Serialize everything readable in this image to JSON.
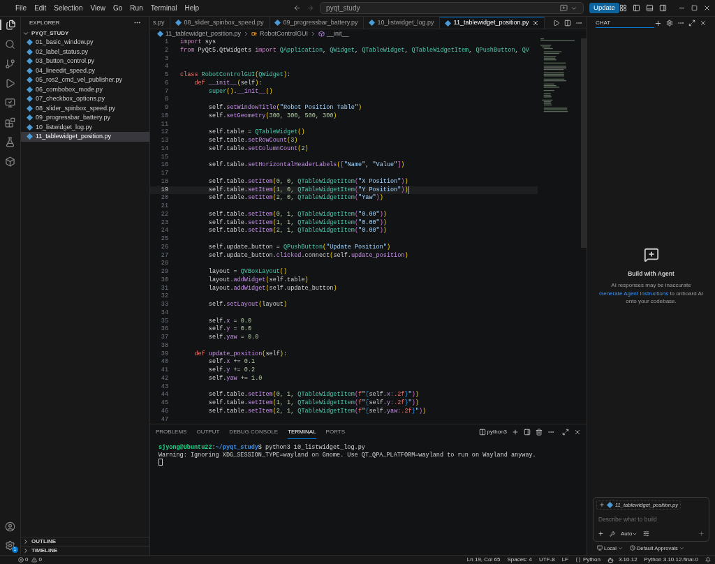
{
  "menu": [
    "File",
    "Edit",
    "Selection",
    "View",
    "Go",
    "Run",
    "Terminal",
    "Help"
  ],
  "command_center": {
    "text": "pyqt_study"
  },
  "update_button": "Update",
  "activity_bar": {
    "settings_badge": "1"
  },
  "explorer": {
    "title": "EXPLORER",
    "folder": "PYQT_STUDY",
    "expanded": true,
    "files": [
      {
        "name": "01_basic_window.py",
        "selected": false
      },
      {
        "name": "02_label_status.py",
        "selected": false
      },
      {
        "name": "03_button_control.py",
        "selected": false
      },
      {
        "name": "04_lineedit_speed.py",
        "selected": false
      },
      {
        "name": "05_ros2_cmd_vel_publisher.py",
        "selected": false
      },
      {
        "name": "06_combobox_mode.py",
        "selected": false
      },
      {
        "name": "07_checkbox_options.py",
        "selected": false
      },
      {
        "name": "08_slider_spinbox_speed.py",
        "selected": false
      },
      {
        "name": "09_progressbar_battery.py",
        "selected": false
      },
      {
        "name": "10_listwidget_log.py",
        "selected": false
      },
      {
        "name": "11_tablewidget_position.py",
        "selected": true
      }
    ],
    "sections": [
      "OUTLINE",
      "TIMELINE"
    ]
  },
  "tabs": [
    {
      "label": "s.py",
      "selected": false
    },
    {
      "label": "08_slider_spinbox_speed.py",
      "selected": false
    },
    {
      "label": "09_progressbar_battery.py",
      "selected": false
    },
    {
      "label": "10_listwidget_log.py",
      "selected": false
    },
    {
      "label": "11_tablewidget_position.py",
      "selected": true
    }
  ],
  "breadcrumb": [
    {
      "kind": "file",
      "text": "11_tablewidget_position.py"
    },
    {
      "kind": "class",
      "text": "RobotControlGUI"
    },
    {
      "kind": "method",
      "text": "__init__"
    }
  ],
  "code": [
    {
      "number": "1",
      "tokens": [
        {
          "kind": "import",
          "text": "import"
        },
        {
          "kind": "plain",
          "text": " sys"
        }
      ]
    },
    {
      "number": "2",
      "tokens": [
        {
          "kind": "import",
          "text": "from"
        },
        {
          "kind": "plain",
          "text": " PyQt5.QtWidgets "
        },
        {
          "kind": "import",
          "text": "import "
        },
        {
          "kind": "class",
          "text": "QApplication"
        },
        {
          "kind": "plain",
          "text": ", "
        },
        {
          "kind": "class",
          "text": "QWidget"
        },
        {
          "kind": "plain",
          "text": ", "
        },
        {
          "kind": "class",
          "text": "QTableWidget"
        },
        {
          "kind": "plain",
          "text": ", "
        },
        {
          "kind": "class",
          "text": "QTableWidgetItem"
        },
        {
          "kind": "plain",
          "text": ", "
        },
        {
          "kind": "class",
          "text": "QPushButton"
        },
        {
          "kind": "plain",
          "text": ", "
        },
        {
          "kind": "class",
          "text": "QV"
        }
      ]
    },
    {
      "number": "3"
    },
    {
      "number": "4"
    },
    {
      "number": "5",
      "tokens": [
        {
          "kind": "keyword",
          "text": "class "
        },
        {
          "kind": "class",
          "text": "RobotControlGUI"
        },
        {
          "kind": "bracket",
          "text": "("
        },
        {
          "kind": "class",
          "text": "QWidget"
        },
        {
          "kind": "bracket",
          "text": ")"
        },
        {
          "kind": "plain",
          "text": ":"
        }
      ]
    },
    {
      "number": "6",
      "tokens": [
        {
          "kind": "keyword",
          "text": "    def "
        },
        {
          "kind": "method",
          "text": "__init__"
        },
        {
          "kind": "bracket",
          "text": "("
        },
        {
          "kind": "plain",
          "text": "self"
        },
        {
          "kind": "bracket",
          "text": ")"
        },
        {
          "kind": "plain",
          "text": ":"
        }
      ]
    },
    {
      "number": "7",
      "tokens": [
        {
          "kind": "class",
          "text": "        super"
        },
        {
          "kind": "bracket",
          "text": "()"
        },
        {
          "kind": "plain",
          "text": "."
        },
        {
          "kind": "method",
          "text": "__init__"
        },
        {
          "kind": "bracket",
          "text": "()"
        }
      ]
    },
    {
      "number": "8"
    },
    {
      "number": "9",
      "tokens": [
        {
          "kind": "plain",
          "text": "        self."
        },
        {
          "kind": "method",
          "text": "setWindowTitle"
        },
        {
          "kind": "bracket",
          "text": "("
        },
        {
          "kind": "string",
          "text": "\"Robot Position Table\""
        },
        {
          "kind": "bracket",
          "text": ")"
        }
      ]
    },
    {
      "number": "10",
      "tokens": [
        {
          "kind": "plain",
          "text": "        self."
        },
        {
          "kind": "method",
          "text": "setGeometry"
        },
        {
          "kind": "bracket",
          "text": "("
        },
        {
          "kind": "number",
          "text": "300, 300, 500, 300"
        },
        {
          "kind": "bracket",
          "text": ")"
        }
      ]
    },
    {
      "number": "11"
    },
    {
      "number": "12",
      "tokens": [
        {
          "kind": "plain",
          "text": "        self.table = "
        },
        {
          "kind": "class",
          "text": "QTableWidget"
        },
        {
          "kind": "bracket",
          "text": "()"
        }
      ]
    },
    {
      "number": "13",
      "tokens": [
        {
          "kind": "plain",
          "text": "        self.table."
        },
        {
          "kind": "method",
          "text": "setRowCount"
        },
        {
          "kind": "bracket",
          "text": "("
        },
        {
          "kind": "number",
          "text": "3"
        },
        {
          "kind": "bracket",
          "text": ")"
        }
      ]
    },
    {
      "number": "14",
      "tokens": [
        {
          "kind": "plain",
          "text": "        self.table."
        },
        {
          "kind": "method",
          "text": "setColumnCount"
        },
        {
          "kind": "bracket",
          "text": "("
        },
        {
          "kind": "number",
          "text": "2"
        },
        {
          "kind": "bracket",
          "text": ")"
        }
      ]
    },
    {
      "number": "15"
    },
    {
      "number": "16",
      "tokens": [
        {
          "kind": "plain",
          "text": "        self.table."
        },
        {
          "kind": "method",
          "text": "setHorizontalHeaderLabels"
        },
        {
          "kind": "bracket",
          "text": "("
        },
        {
          "kind": "bracket2",
          "text": "["
        },
        {
          "kind": "string",
          "text": "\"Name\""
        },
        {
          "kind": "plain",
          "text": ", "
        },
        {
          "kind": "string",
          "text": "\"Value\""
        },
        {
          "kind": "bracket2",
          "text": "]"
        },
        {
          "kind": "bracket",
          "text": ")"
        }
      ]
    },
    {
      "number": "17"
    },
    {
      "number": "18",
      "tokens": [
        {
          "kind": "plain",
          "text": "        self.table."
        },
        {
          "kind": "method",
          "text": "setItem"
        },
        {
          "kind": "bracket",
          "text": "("
        },
        {
          "kind": "number",
          "text": "0, 0, "
        },
        {
          "kind": "class",
          "text": "QTableWidgetItem"
        },
        {
          "kind": "bracket2",
          "text": "("
        },
        {
          "kind": "string",
          "text": "\"X Position\""
        },
        {
          "kind": "bracket2",
          "text": ")"
        },
        {
          "kind": "bracket",
          "text": ")"
        }
      ]
    },
    {
      "number": "19",
      "current": true,
      "tokens": [
        {
          "kind": "plain",
          "text": "        self.table."
        },
        {
          "kind": "method",
          "text": "setItem"
        },
        {
          "kind": "bracket",
          "text": "("
        },
        {
          "kind": "number",
          "text": "1, 0, "
        },
        {
          "kind": "class",
          "text": "QTableWidgetItem"
        },
        {
          "kind": "bracket2",
          "text": "("
        },
        {
          "kind": "string",
          "text": "\"Y Position\""
        },
        {
          "kind": "bracket2",
          "text": ")"
        },
        {
          "kind": "bracket",
          "text": ")"
        }
      ]
    },
    {
      "number": "20",
      "tokens": [
        {
          "kind": "plain",
          "text": "        self.table."
        },
        {
          "kind": "method",
          "text": "setItem"
        },
        {
          "kind": "bracket",
          "text": "("
        },
        {
          "kind": "number",
          "text": "2, 0, "
        },
        {
          "kind": "class",
          "text": "QTableWidgetItem"
        },
        {
          "kind": "bracket2",
          "text": "("
        },
        {
          "kind": "string",
          "text": "\"Yaw\""
        },
        {
          "kind": "bracket2",
          "text": ")"
        },
        {
          "kind": "bracket",
          "text": ")"
        }
      ]
    },
    {
      "number": "21"
    },
    {
      "number": "22",
      "tokens": [
        {
          "kind": "plain",
          "text": "        self.table."
        },
        {
          "kind": "method",
          "text": "setItem"
        },
        {
          "kind": "bracket",
          "text": "("
        },
        {
          "kind": "number",
          "text": "0, 1, "
        },
        {
          "kind": "class",
          "text": "QTableWidgetItem"
        },
        {
          "kind": "bracket2",
          "text": "("
        },
        {
          "kind": "string",
          "text": "\"0.00\""
        },
        {
          "kind": "bracket2",
          "text": ")"
        },
        {
          "kind": "bracket",
          "text": ")"
        }
      ]
    },
    {
      "number": "23",
      "tokens": [
        {
          "kind": "plain",
          "text": "        self.table."
        },
        {
          "kind": "method",
          "text": "setItem"
        },
        {
          "kind": "bracket",
          "text": "("
        },
        {
          "kind": "number",
          "text": "1, 1, "
        },
        {
          "kind": "class",
          "text": "QTableWidgetItem"
        },
        {
          "kind": "bracket2",
          "text": "("
        },
        {
          "kind": "string",
          "text": "\"0.00\""
        },
        {
          "kind": "bracket2",
          "text": ")"
        },
        {
          "kind": "bracket",
          "text": ")"
        }
      ]
    },
    {
      "number": "24",
      "tokens": [
        {
          "kind": "plain",
          "text": "        self.table."
        },
        {
          "kind": "method",
          "text": "setItem"
        },
        {
          "kind": "bracket",
          "text": "("
        },
        {
          "kind": "number",
          "text": "2, 1, "
        },
        {
          "kind": "class",
          "text": "QTableWidgetItem"
        },
        {
          "kind": "bracket2",
          "text": "("
        },
        {
          "kind": "string",
          "text": "\"0.00\""
        },
        {
          "kind": "bracket2",
          "text": ")"
        },
        {
          "kind": "bracket",
          "text": ")"
        }
      ]
    },
    {
      "number": "25"
    },
    {
      "number": "26",
      "tokens": [
        {
          "kind": "plain",
          "text": "        self.update_button = "
        },
        {
          "kind": "class",
          "text": "QPushButton"
        },
        {
          "kind": "bracket",
          "text": "("
        },
        {
          "kind": "string",
          "text": "\"Update Position\""
        },
        {
          "kind": "bracket",
          "text": ")"
        }
      ]
    },
    {
      "number": "27",
      "tokens": [
        {
          "kind": "plain",
          "text": "        self.update_button."
        },
        {
          "kind": "method",
          "text": "clicked"
        },
        {
          "kind": "plain",
          "text": ".connect"
        },
        {
          "kind": "bracket",
          "text": "("
        },
        {
          "kind": "plain",
          "text": "self."
        },
        {
          "kind": "method",
          "text": "update_position"
        },
        {
          "kind": "bracket",
          "text": ")"
        }
      ]
    },
    {
      "number": "28"
    },
    {
      "number": "29",
      "tokens": [
        {
          "kind": "plain",
          "text": "        layout = "
        },
        {
          "kind": "class",
          "text": "QVBoxLayout"
        },
        {
          "kind": "bracket",
          "text": "()"
        }
      ]
    },
    {
      "number": "30",
      "tokens": [
        {
          "kind": "plain",
          "text": "        layout."
        },
        {
          "kind": "method",
          "text": "addWidget"
        },
        {
          "kind": "bracket",
          "text": "("
        },
        {
          "kind": "plain",
          "text": "self.table"
        },
        {
          "kind": "bracket",
          "text": ")"
        }
      ]
    },
    {
      "number": "31",
      "tokens": [
        {
          "kind": "plain",
          "text": "        layout."
        },
        {
          "kind": "method",
          "text": "addWidget"
        },
        {
          "kind": "bracket",
          "text": "("
        },
        {
          "kind": "plain",
          "text": "self.update_button"
        },
        {
          "kind": "bracket",
          "text": ")"
        }
      ]
    },
    {
      "number": "32"
    },
    {
      "number": "33",
      "tokens": [
        {
          "kind": "plain",
          "text": "        self."
        },
        {
          "kind": "method",
          "text": "setLayout"
        },
        {
          "kind": "bracket",
          "text": "("
        },
        {
          "kind": "plain",
          "text": "layout"
        },
        {
          "kind": "bracket",
          "text": ")"
        }
      ]
    },
    {
      "number": "34"
    },
    {
      "number": "35",
      "tokens": [
        {
          "kind": "plain",
          "text": "        self."
        },
        {
          "kind": "method",
          "text": "x"
        },
        {
          "kind": "plain",
          "text": " = "
        },
        {
          "kind": "number",
          "text": "0.0"
        }
      ]
    },
    {
      "number": "36",
      "tokens": [
        {
          "kind": "plain",
          "text": "        self."
        },
        {
          "kind": "method",
          "text": "y"
        },
        {
          "kind": "plain",
          "text": " = "
        },
        {
          "kind": "number",
          "text": "0.0"
        }
      ]
    },
    {
      "number": "37",
      "tokens": [
        {
          "kind": "plain",
          "text": "        self."
        },
        {
          "kind": "method",
          "text": "yaw"
        },
        {
          "kind": "plain",
          "text": " = "
        },
        {
          "kind": "number",
          "text": "0.0"
        }
      ]
    },
    {
      "number": "38"
    },
    {
      "number": "39",
      "tokens": [
        {
          "kind": "keyword",
          "text": "    def "
        },
        {
          "kind": "method",
          "text": "update_position"
        },
        {
          "kind": "bracket",
          "text": "("
        },
        {
          "kind": "plain",
          "text": "self"
        },
        {
          "kind": "bracket",
          "text": ")"
        },
        {
          "kind": "plain",
          "text": ":"
        }
      ]
    },
    {
      "number": "40",
      "tokens": [
        {
          "kind": "plain",
          "text": "        self."
        },
        {
          "kind": "method",
          "text": "x"
        },
        {
          "kind": "plain",
          "text": " += "
        },
        {
          "kind": "number",
          "text": "0.1"
        }
      ]
    },
    {
      "number": "41",
      "tokens": [
        {
          "kind": "plain",
          "text": "        self."
        },
        {
          "kind": "method",
          "text": "y"
        },
        {
          "kind": "plain",
          "text": " += "
        },
        {
          "kind": "number",
          "text": "0.2"
        }
      ]
    },
    {
      "number": "42",
      "tokens": [
        {
          "kind": "plain",
          "text": "        self."
        },
        {
          "kind": "method",
          "text": "yaw"
        },
        {
          "kind": "plain",
          "text": " += "
        },
        {
          "kind": "number",
          "text": "1.0"
        }
      ]
    },
    {
      "number": "43"
    },
    {
      "number": "44",
      "tokens": [
        {
          "kind": "plain",
          "text": "        self.table."
        },
        {
          "kind": "method",
          "text": "setItem"
        },
        {
          "kind": "bracket",
          "text": "("
        },
        {
          "kind": "number",
          "text": "0, 1, "
        },
        {
          "kind": "class",
          "text": "QTableWidgetItem"
        },
        {
          "kind": "bracket2",
          "text": "("
        },
        {
          "kind": "keyword",
          "text": "f"
        },
        {
          "kind": "string",
          "text": "\""
        },
        {
          "kind": "bracket3",
          "text": "{"
        },
        {
          "kind": "plain",
          "text": "self."
        },
        {
          "kind": "method",
          "text": "x"
        },
        {
          "kind": "keyword",
          "text": ":.2f"
        },
        {
          "kind": "bracket3",
          "text": "}"
        },
        {
          "kind": "string",
          "text": "\""
        },
        {
          "kind": "bracket2",
          "text": ")"
        },
        {
          "kind": "bracket",
          "text": ")"
        }
      ]
    },
    {
      "number": "45",
      "tokens": [
        {
          "kind": "plain",
          "text": "        self.table."
        },
        {
          "kind": "method",
          "text": "setItem"
        },
        {
          "kind": "bracket",
          "text": "("
        },
        {
          "kind": "number",
          "text": "1, 1, "
        },
        {
          "kind": "class",
          "text": "QTableWidgetItem"
        },
        {
          "kind": "bracket2",
          "text": "("
        },
        {
          "kind": "keyword",
          "text": "f"
        },
        {
          "kind": "string",
          "text": "\""
        },
        {
          "kind": "bracket3",
          "text": "{"
        },
        {
          "kind": "plain",
          "text": "self."
        },
        {
          "kind": "method",
          "text": "y"
        },
        {
          "kind": "keyword",
          "text": ":.2f"
        },
        {
          "kind": "bracket3",
          "text": "}"
        },
        {
          "kind": "string",
          "text": "\""
        },
        {
          "kind": "bracket2",
          "text": ")"
        },
        {
          "kind": "bracket",
          "text": ")"
        }
      ]
    },
    {
      "number": "46",
      "tokens": [
        {
          "kind": "plain",
          "text": "        self.table."
        },
        {
          "kind": "method",
          "text": "setItem"
        },
        {
          "kind": "bracket",
          "text": "("
        },
        {
          "kind": "number",
          "text": "2, 1, "
        },
        {
          "kind": "class",
          "text": "QTableWidgetItem"
        },
        {
          "kind": "bracket2",
          "text": "("
        },
        {
          "kind": "keyword",
          "text": "f"
        },
        {
          "kind": "string",
          "text": "\""
        },
        {
          "kind": "bracket3",
          "text": "{"
        },
        {
          "kind": "plain",
          "text": "self."
        },
        {
          "kind": "method",
          "text": "yaw"
        },
        {
          "kind": "keyword",
          "text": ":.2f"
        },
        {
          "kind": "bracket3",
          "text": "}"
        },
        {
          "kind": "string",
          "text": "\""
        },
        {
          "kind": "bracket2",
          "text": ")"
        },
        {
          "kind": "bracket",
          "text": ")"
        }
      ]
    },
    {
      "number": "47"
    }
  ],
  "panel": {
    "tabs": [
      {
        "label": "PROBLEMS",
        "selected": false
      },
      {
        "label": "OUTPUT",
        "selected": false
      },
      {
        "label": "DEBUG CONSOLE",
        "selected": false
      },
      {
        "label": "TERMINAL",
        "selected": true
      },
      {
        "label": "PORTS",
        "selected": false
      }
    ],
    "terminal_name": "python3",
    "lines": [
      {
        "tokens": [
          {
            "kind": "user",
            "text": "sjyong@Ubuntu22"
          },
          {
            "kind": "plain",
            "text": ":"
          },
          {
            "kind": "path",
            "text": "~/pyqt_study"
          },
          {
            "kind": "plain",
            "text": "$ python3 10_listwidget_log.py"
          }
        ]
      },
      {
        "tokens": [
          {
            "kind": "plain",
            "text": "Warning: Ignoring XDG_SESSION_TYPE=wayland on Gnome. Use QT_QPA_PLATFORM=wayland to run on Wayland anyway."
          }
        ]
      }
    ]
  },
  "chat": {
    "title": "CHAT",
    "heading": "Build with Agent",
    "note": "AI responses may be inaccurate",
    "link": "Generate Agent Instructions",
    "link_rest": " to onboard AI onto your codebase.",
    "context_file": "11_tablewidget_position.py",
    "placeholder": "Describe what to build",
    "mode": "Auto",
    "location": "Local",
    "approvals": "Default Approvals"
  },
  "status_bar": {
    "errors": "0",
    "warnings": "0",
    "items": [
      {
        "kind": "text",
        "text": "Ln 19, Col 65"
      },
      {
        "kind": "text",
        "text": "Spaces: 4"
      },
      {
        "kind": "text",
        "text": "UTF-8"
      },
      {
        "kind": "text",
        "text": "LF"
      },
      {
        "kind": "language",
        "text": "Python"
      },
      {
        "kind": "version",
        "text": "3.10.12"
      },
      {
        "kind": "text",
        "text": "Python 3.10.12.final.0"
      }
    ]
  }
}
